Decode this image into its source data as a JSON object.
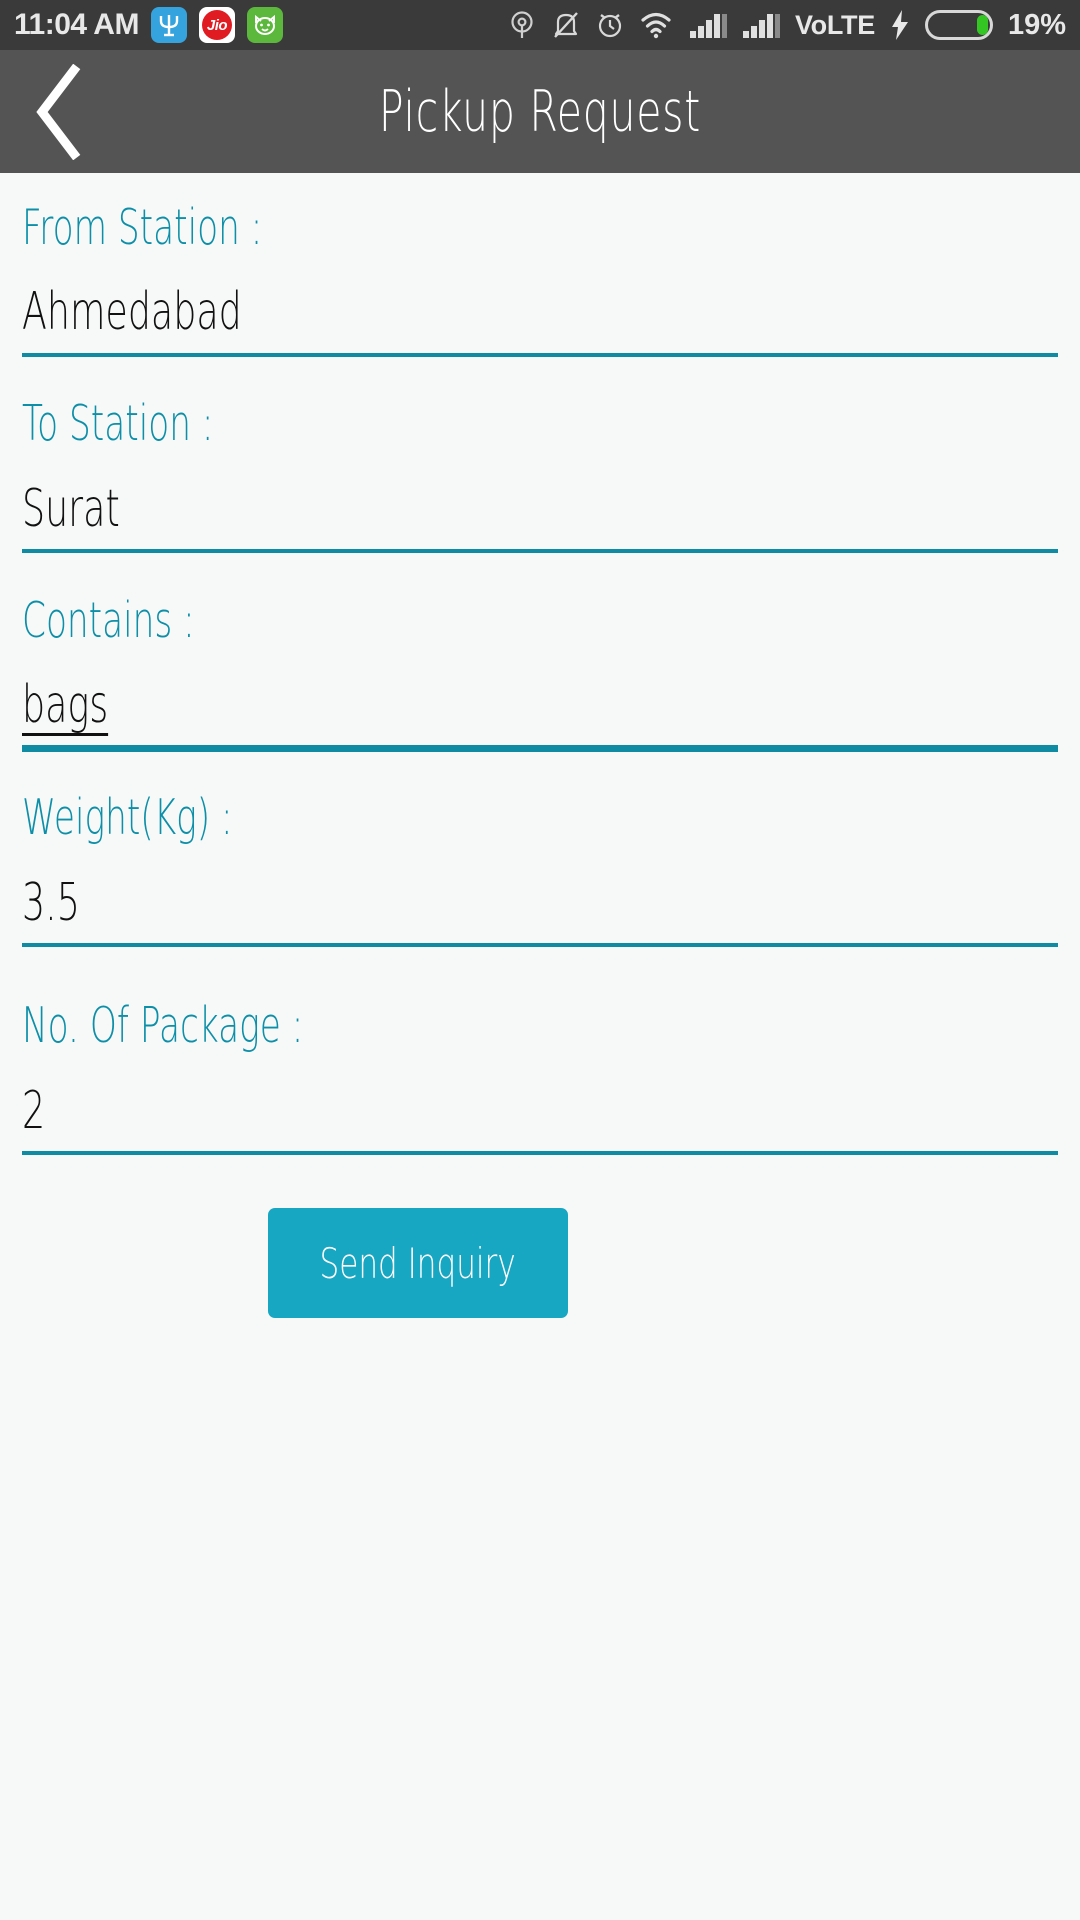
{
  "status_bar": {
    "time": "11:04 AM",
    "app_badges": [
      {
        "name": "trident-app-icon",
        "glyph": "Ψ"
      },
      {
        "name": "jio-app-icon",
        "glyph": "Jio"
      },
      {
        "name": "cat-app-icon",
        "glyph": "○"
      }
    ],
    "icons": [
      "location-icon",
      "mute-bell-icon",
      "alarm-clock-icon",
      "wifi-icon",
      "signal-bars-sim1-icon",
      "signal-bars-sim2-icon"
    ],
    "network_label": "VoLTE",
    "charging": true,
    "battery_percent": "19%",
    "battery_level": 19,
    "battery_fill_color": "#34c724",
    "background_color": "#3a3a3a"
  },
  "app_bar": {
    "back_label": "Back",
    "title": "Pickup Request",
    "background_color": "#545454"
  },
  "theme": {
    "accent": "#0f8ca4",
    "label_color": "#0d8fa8",
    "button_color": "#17a7c3",
    "page_background": "#f7f8f8"
  },
  "form": {
    "fields": [
      {
        "label": "From Station :",
        "value": "Ahmedabad",
        "composing": false
      },
      {
        "label": "To Station :",
        "value": "Surat",
        "composing": false
      },
      {
        "label": "Contains :",
        "value": "bags",
        "composing": true
      },
      {
        "label": "Weight(Kg) :",
        "value": "3.5",
        "composing": false
      },
      {
        "label": "No. Of Package :",
        "value": "2",
        "composing": false
      }
    ],
    "submit_label": "Send Inquiry"
  }
}
